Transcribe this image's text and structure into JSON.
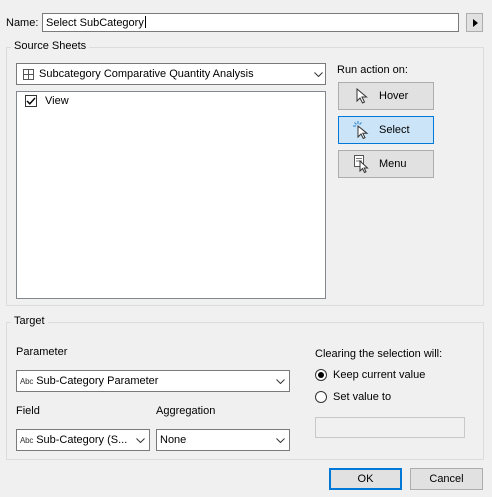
{
  "name_label": "Name:",
  "name_value": "Select SubCategory",
  "source": {
    "title": "Source Sheets",
    "sheet_dropdown": "Subcategory Comparative Quantity Analysis",
    "list_items": [
      {
        "label": "View",
        "checked": true
      }
    ]
  },
  "run_action": {
    "label": "Run action on:",
    "buttons": [
      {
        "label": "Hover",
        "icon": "pointer-icon",
        "selected": false
      },
      {
        "label": "Select",
        "icon": "select-pointer-icon",
        "selected": true
      },
      {
        "label": "Menu",
        "icon": "menu-pointer-icon",
        "selected": false
      }
    ]
  },
  "target": {
    "title": "Target",
    "parameter_label": "Parameter",
    "parameter_type": "Abc",
    "parameter_value": "Sub-Category Parameter",
    "field_label": "Field",
    "field_type": "Abc",
    "field_value": "Sub-Category (S...",
    "aggregation_label": "Aggregation",
    "aggregation_value": "None"
  },
  "clearing": {
    "label": "Clearing the selection will:",
    "options": [
      {
        "label": "Keep current value",
        "selected": true
      },
      {
        "label": "Set value to",
        "selected": false
      }
    ],
    "set_value": ""
  },
  "footer": {
    "ok": "OK",
    "cancel": "Cancel"
  },
  "colors": {
    "accent": "#0078d7",
    "selected_bg": "#cce4f7",
    "dialog_bg": "#f0f0f0"
  }
}
